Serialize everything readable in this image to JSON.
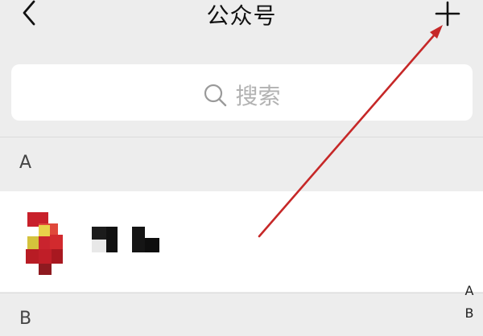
{
  "header": {
    "title": "公众号",
    "back_icon": "chevron-left-icon",
    "add_icon": "plus-icon"
  },
  "search": {
    "placeholder": "搜索",
    "icon": "search-icon"
  },
  "sections": [
    {
      "letter": "A"
    },
    {
      "letter": "B"
    }
  ],
  "index_bar": [
    "A",
    "B"
  ],
  "colors": {
    "background": "#ededed",
    "card": "#ffffff",
    "placeholder": "#b2b2b2",
    "annotation_arrow": "#c62828"
  }
}
